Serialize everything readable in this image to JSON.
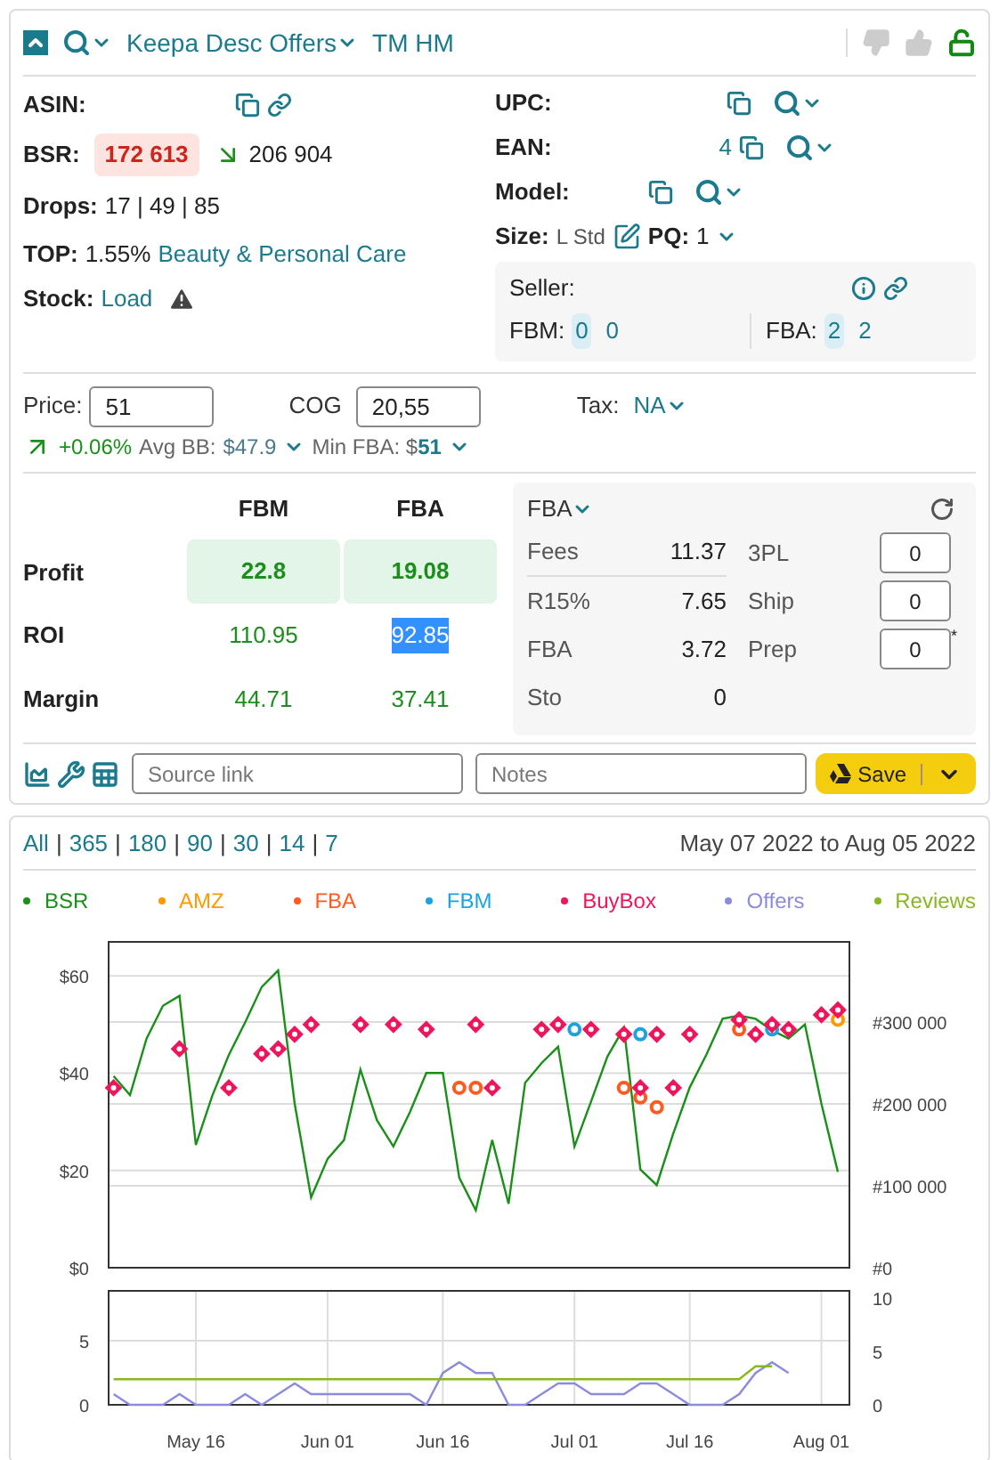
{
  "header": {
    "title": "Keepa Desc Offers",
    "tag": "TM HM"
  },
  "left_fields": [
    {
      "kind": "asin",
      "label": "ASIN:"
    },
    {
      "kind": "bsr",
      "label": "BSR:",
      "value": "172 613",
      "previous": "206 904"
    },
    {
      "kind": "text",
      "label": "Drops:",
      "value": "17 | 49 | 85"
    },
    {
      "kind": "top",
      "label": "TOP:",
      "value": "1.55%",
      "link": "Beauty & Personal Care"
    },
    {
      "kind": "stock",
      "label": "Stock:",
      "link": "Load"
    }
  ],
  "right_fields": [
    {
      "kind": "upc",
      "label": "UPC:"
    },
    {
      "kind": "ean",
      "label": "EAN:",
      "value": "4"
    },
    {
      "kind": "model",
      "label": "Model:"
    },
    {
      "kind": "size",
      "label": "Size:",
      "value": "L Std",
      "pq_label": "PQ:",
      "pq_value": "1"
    }
  ],
  "seller": {
    "label": "Seller:",
    "fbm_label": "FBM:",
    "fbm_badge": "0",
    "fbm_value": "0",
    "fba_label": "FBA:",
    "fba_badge": "2",
    "fba_value": "2"
  },
  "pricing": {
    "price_label": "Price:",
    "price": "51",
    "cog_label": "COG",
    "cog": "20,55",
    "tax_label": "Tax:",
    "tax": "NA"
  },
  "trend": {
    "change": "+0.06%",
    "avg_label": "Avg BB:",
    "avg": "$47.9",
    "min_label": "Min FBA: $",
    "min": "51"
  },
  "profit": {
    "columns": [
      "FBM",
      "FBA"
    ],
    "rows": [
      {
        "label": "Profit",
        "emphasis": true,
        "cells": [
          {
            "value": "22.8",
            "highlighted": false
          },
          {
            "value": "19.08",
            "highlighted": false
          }
        ]
      },
      {
        "label": "ROI",
        "emphasis": false,
        "cells": [
          {
            "value": "110.95",
            "highlighted": false
          },
          {
            "value": "92.85",
            "highlighted": true
          }
        ]
      },
      {
        "label": "Margin",
        "emphasis": false,
        "cells": [
          {
            "value": "44.71",
            "highlighted": false
          },
          {
            "value": "37.41",
            "highlighted": false
          }
        ]
      }
    ]
  },
  "fees": {
    "mode": "FBA",
    "items": [
      {
        "label": "Fees",
        "value": "11.37"
      },
      {
        "label": "R15%",
        "value": "7.65"
      },
      {
        "label": "FBA",
        "value": "3.72"
      },
      {
        "label": "Sto",
        "value": "0"
      }
    ],
    "extras": [
      {
        "label": "3PL",
        "value": "0"
      },
      {
        "label": "Ship",
        "value": "0"
      },
      {
        "label": "Prep",
        "value": "0",
        "note": "*"
      }
    ]
  },
  "toolbar": {
    "source_placeholder": "Source link",
    "notes_placeholder": "Notes",
    "save": "Save"
  },
  "ranges": {
    "separator": "|",
    "items": [
      "All",
      "365",
      "180",
      "90",
      "30",
      "14",
      "7"
    ]
  },
  "date_range": "May 07 2022 to Aug 05 2022",
  "price_chart": {
    "chart_data": {
      "type": "line",
      "grid": true,
      "categories": [
        null,
        null,
        null,
        null,
        null,
        null,
        null,
        null,
        null,
        null,
        null,
        null,
        null,
        null,
        null,
        null,
        null,
        null,
        null,
        null,
        null,
        null,
        null,
        null,
        null,
        null,
        null,
        null,
        null,
        null,
        null,
        null,
        null,
        null,
        null,
        null,
        null,
        null,
        null,
        null,
        null,
        null,
        null,
        null,
        null
      ],
      "ylim": [
        0,
        67
      ],
      "yticks": [
        {
          "value": 0,
          "label": "$0"
        },
        {
          "value": 20,
          "label": "$20"
        },
        {
          "value": 40,
          "label": "$40"
        },
        {
          "value": 60,
          "label": "$60"
        }
      ],
      "y2lim": [
        0,
        398000
      ],
      "y2ticks": [
        {
          "value": 0,
          "label": "#0"
        },
        {
          "value": 100000,
          "label": "#100 000"
        },
        {
          "value": 200000,
          "label": "#200 000"
        },
        {
          "value": 300000,
          "label": "#300 000"
        }
      ],
      "series": [
        {
          "name": "BSR",
          "color": "#1a8f1a",
          "type": "line",
          "axis": "y2",
          "values": [
            234000,
            211000,
            280000,
            320000,
            332000,
            150000,
            210000,
            260000,
            300000,
            343000,
            363000,
            200000,
            86000,
            133000,
            156000,
            242000,
            180000,
            148000,
            190000,
            238000,
            238000,
            110000,
            70000,
            156000,
            78000,
            226000,
            250000,
            270000,
            148000,
            203000,
            258000,
            293000,
            120000,
            101000,
            164000,
            220000,
            260000,
            304000,
            308000,
            304000,
            290000,
            280000,
            297000,
            200000,
            117000
          ]
        },
        {
          "name": "AMZ",
          "color": "#ff9900",
          "type": "scatter",
          "marker": "circle",
          "values": [
            null,
            null,
            null,
            null,
            null,
            null,
            null,
            null,
            null,
            null,
            null,
            null,
            null,
            null,
            null,
            null,
            null,
            null,
            null,
            null,
            null,
            null,
            null,
            null,
            null,
            null,
            null,
            null,
            null,
            null,
            null,
            null,
            null,
            null,
            null,
            null,
            null,
            null,
            null,
            null,
            null,
            null,
            null,
            null,
            51
          ]
        },
        {
          "name": "FBA",
          "color": "#ff5a1f",
          "type": "scatter",
          "marker": "circle",
          "values": [
            null,
            null,
            null,
            null,
            null,
            null,
            null,
            null,
            null,
            null,
            null,
            null,
            null,
            null,
            null,
            null,
            null,
            null,
            null,
            null,
            null,
            37,
            37,
            null,
            null,
            null,
            null,
            null,
            null,
            null,
            null,
            37,
            35,
            33,
            null,
            null,
            null,
            null,
            49,
            null,
            null,
            null,
            null,
            null,
            null
          ]
        },
        {
          "name": "FBM",
          "color": "#1aa3e0",
          "type": "scatter",
          "marker": "circle",
          "values": [
            null,
            null,
            null,
            null,
            null,
            null,
            null,
            null,
            null,
            null,
            null,
            null,
            null,
            null,
            null,
            null,
            null,
            null,
            null,
            null,
            null,
            null,
            null,
            null,
            null,
            null,
            null,
            null,
            49,
            null,
            null,
            null,
            48,
            null,
            null,
            null,
            null,
            null,
            null,
            null,
            49,
            null,
            null,
            null,
            null
          ]
        },
        {
          "name": "BuyBox",
          "color": "#f0145a",
          "type": "scatter",
          "marker": "diamond",
          "values": [
            37,
            null,
            null,
            null,
            45,
            null,
            null,
            37,
            null,
            44,
            45,
            48,
            50,
            null,
            null,
            50,
            null,
            50,
            null,
            49,
            null,
            null,
            50,
            37,
            null,
            null,
            49,
            50,
            null,
            49,
            null,
            48,
            37,
            48,
            37,
            48,
            null,
            null,
            51,
            48,
            50,
            49,
            null,
            52,
            53
          ]
        }
      ]
    }
  },
  "offers_chart": {
    "chart_data": {
      "type": "line",
      "grid": true,
      "categories": [
        null,
        null,
        null,
        null,
        null,
        "May 16",
        null,
        null,
        null,
        null,
        null,
        null,
        null,
        "Jun 01",
        null,
        null,
        null,
        null,
        null,
        null,
        "Jun 16",
        null,
        null,
        null,
        null,
        null,
        null,
        null,
        "Jul 01",
        null,
        null,
        null,
        null,
        null,
        null,
        "Jul 16",
        null,
        null,
        null,
        null,
        null,
        null,
        null,
        "Aug 01",
        null
      ],
      "ylim": [
        0,
        8.9
      ],
      "yticks": [
        {
          "value": 0,
          "label": "0"
        },
        {
          "value": 5,
          "label": "5"
        }
      ],
      "y2lim": [
        0,
        10.7
      ],
      "y2ticks": [
        {
          "value": 0,
          "label": "0"
        },
        {
          "value": 5,
          "label": "5"
        },
        {
          "value": 10,
          "label": "10"
        }
      ],
      "series": [
        {
          "name": "Offers",
          "color": "#8c8cdc",
          "type": "line",
          "axis": "y2",
          "values": [
            1,
            0,
            0,
            0,
            1,
            0,
            0,
            0,
            1,
            0,
            1,
            2,
            1,
            1,
            1,
            1,
            1,
            1,
            1,
            0,
            3,
            4,
            3,
            3,
            0,
            0,
            1,
            2,
            2,
            1,
            1,
            1,
            2,
            2,
            1,
            0,
            0,
            0,
            1,
            3,
            4,
            3,
            null,
            null,
            null
          ]
        },
        {
          "name": "Reviews",
          "color": "#88b820",
          "type": "line",
          "values": [
            2,
            2,
            2,
            2,
            2,
            2,
            2,
            2,
            2,
            2,
            2,
            2,
            2,
            2,
            2,
            2,
            2,
            2,
            2,
            2,
            2,
            2,
            2,
            2,
            2,
            2,
            2,
            2,
            2,
            2,
            2,
            2,
            2,
            2,
            2,
            2,
            2,
            2,
            2,
            3,
            3,
            null,
            null,
            null,
            null
          ]
        }
      ]
    }
  }
}
